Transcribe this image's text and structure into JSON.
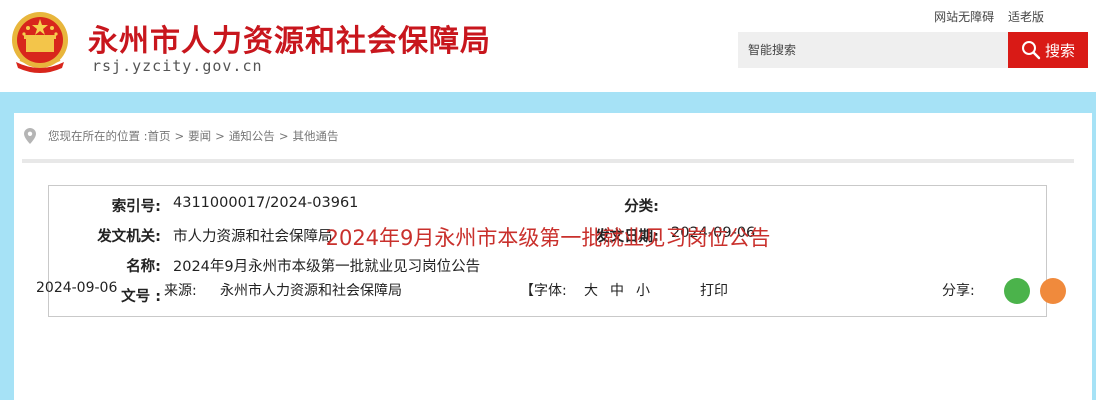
{
  "header": {
    "site_title": "永州市人力资源和社会保障局",
    "site_url": "rsj.yzcity.gov.cn",
    "top_links": [
      "网站无障碍",
      "适老版"
    ],
    "search": {
      "placeholder": "智能搜索",
      "button_label": "搜索"
    }
  },
  "breadcrumb": {
    "prefix": "您现在所在的位置 :",
    "items": [
      "首页",
      "要闻",
      "通知公告",
      "其他通告"
    ],
    "separator": ">"
  },
  "meta": {
    "index_label": "索引号:",
    "index_value": "4311000017/2024-03961",
    "category_label": "分类:",
    "category_value": "",
    "issuer_label": "发文机关:",
    "issuer_value": "市人力资源和社会保障局",
    "date_label": "发文日期:",
    "date_value": "2024-09-06",
    "name_label": "名称:",
    "name_value": "2024年9月永州市本级第一批就业见习岗位公告",
    "docno_label": "文号 :",
    "docno_value": ""
  },
  "article": {
    "title": "2024年9月永州市本级第一批就业见习岗位公告",
    "date": "2024-09-06",
    "source_label": "来源:",
    "source_value": "永州市人力资源和社会保障局",
    "font_label": "【字体:",
    "font_sizes": [
      "大",
      "中",
      "小"
    ],
    "print_label": "打印",
    "share_label": "分享:"
  },
  "colors": {
    "brand_red": "#c8161d",
    "search_button": "#d91a16",
    "band_blue": "#a6e2f6",
    "title_red": "#c9302c"
  },
  "icons": [
    "national-emblem-icon",
    "search-icon",
    "location-pin-icon",
    "wechat-share-icon",
    "weibo-share-icon"
  ]
}
